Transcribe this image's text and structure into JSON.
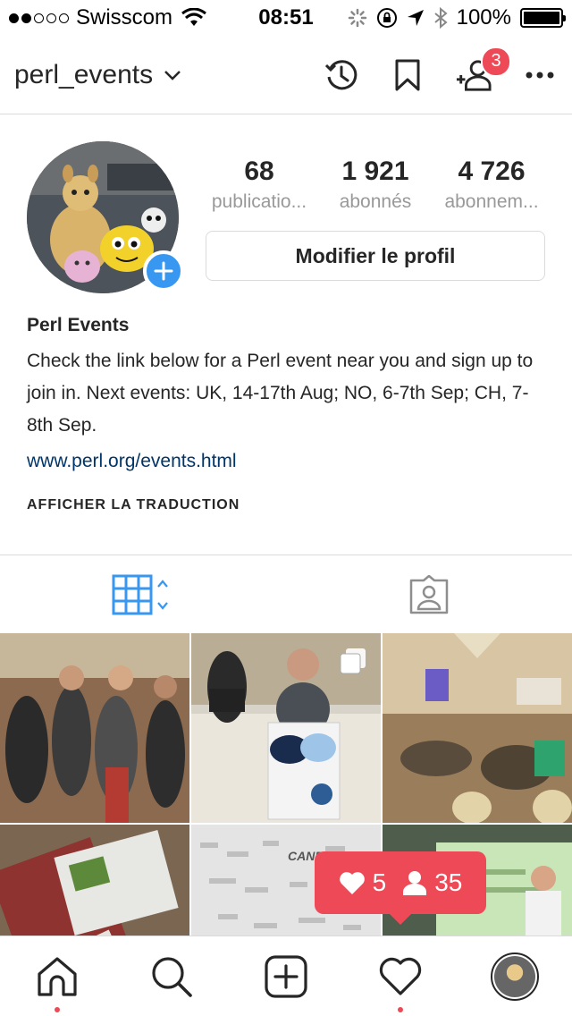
{
  "status_bar": {
    "carrier": "Swisscom",
    "time": "08:51",
    "battery": "100%"
  },
  "header": {
    "username": "perl_events",
    "notification_count": "3"
  },
  "profile": {
    "stats": [
      {
        "value": "68",
        "label": "publicatio..."
      },
      {
        "value": "1 921",
        "label": "abonnés"
      },
      {
        "value": "4 726",
        "label": "abonnem..."
      }
    ],
    "edit_button": "Modifier le profil",
    "name": "Perl Events",
    "bio": "Check the link below for a Perl event near you and sign up to join in. Next events: UK, 14-17th Aug; NO, 6-7th Sep; CH, 7-8th Sep.",
    "link": "www.perl.org/events.html",
    "translate": "AFFICHER LA TRADUCTION"
  },
  "tabs": [
    {
      "icon": "grid-icon",
      "active": true
    },
    {
      "icon": "tagged-photos-icon",
      "active": false
    }
  ],
  "grid_posts": [
    {
      "subject": "people-crowd-photo",
      "color": "#7a5a44"
    },
    {
      "subject": "conference-booth-photo",
      "color": "#c9c2b4"
    },
    {
      "subject": "conference-room-photo",
      "color": "#8a7458"
    },
    {
      "subject": "badges-photo",
      "color": "#6d5a4c"
    },
    {
      "subject": "magnets-wall-photo",
      "color": "#d8d8d8"
    },
    {
      "subject": "speaker-photo",
      "color": "#5c6b58"
    }
  ],
  "activity": {
    "likes": "5",
    "follows": "35"
  },
  "bottom_bar": [
    "home-icon",
    "search-icon",
    "new-post-icon",
    "activity-icon",
    "profile-avatar"
  ],
  "colors": {
    "accent": "#3897f0",
    "badge": "#ed4956",
    "link": "#003569"
  }
}
